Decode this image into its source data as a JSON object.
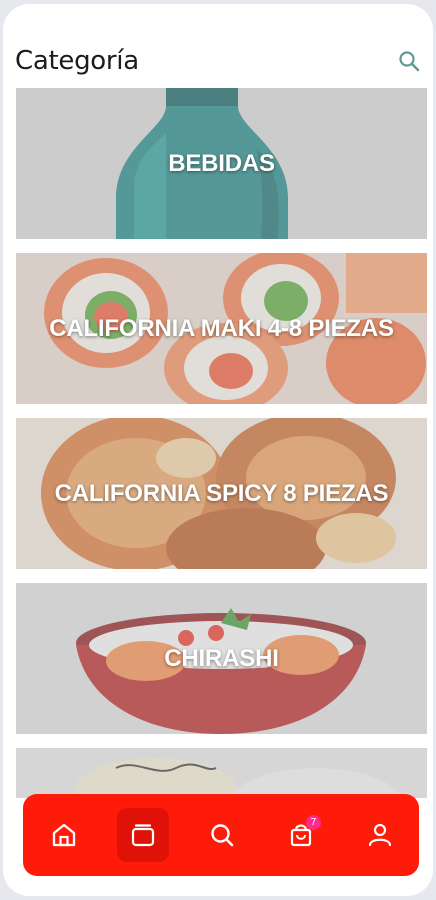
{
  "header": {
    "title": "Categoría"
  },
  "categories": [
    {
      "label": "BEBIDAS"
    },
    {
      "label": "CALIFORNIA MAKI 4-8 PIEZAS"
    },
    {
      "label": "CALIFORNIA SPICY 8 PIEZAS"
    },
    {
      "label": "CHIRASHI"
    },
    {
      "label": ""
    }
  ],
  "bottom_nav": {
    "items": [
      {
        "icon": "home-icon"
      },
      {
        "icon": "categories-icon",
        "active": true
      },
      {
        "icon": "search-icon"
      },
      {
        "icon": "cart-icon",
        "badge": "7"
      },
      {
        "icon": "profile-icon"
      }
    ]
  },
  "colors": {
    "nav_background": "#ff1a0a",
    "badge": "#ff2a8a",
    "title_text": "#1c1c1c"
  }
}
